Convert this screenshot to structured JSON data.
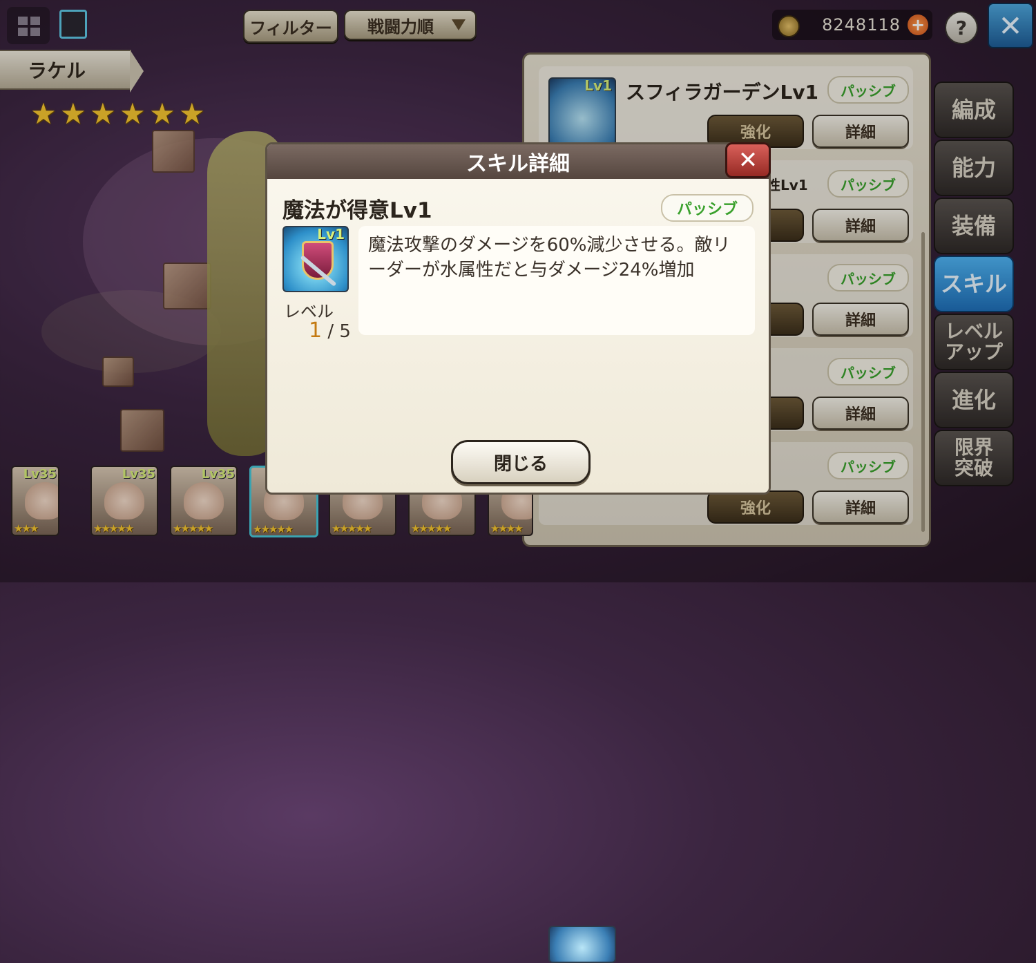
{
  "top_bar": {
    "filter_label": "フィルター",
    "sort_label": "戦闘力順",
    "currency_amount": "8248118",
    "help_icon": "?",
    "close_icon": "✕"
  },
  "character": {
    "name": "ラケル",
    "stars": 6
  },
  "skill_list": [
    {
      "title": "スフィラガーデンLv1",
      "type": "パッシブ",
      "enhance_label": "強化",
      "detail_label": "詳細",
      "icon_level": "Lv1"
    },
    {
      "title": "性Lv1",
      "type": "パッシブ",
      "enhance_label": "",
      "detail_label": "詳細"
    },
    {
      "title": "",
      "type": "パッシブ",
      "enhance_label": "",
      "detail_label": "詳細"
    },
    {
      "title": "",
      "type": "パッシブ",
      "enhance_label": "",
      "detail_label": "詳細"
    },
    {
      "title": "",
      "type": "パッシブ",
      "enhance_label": "強化",
      "detail_label": "詳細"
    }
  ],
  "side_menu": [
    "編成",
    "能力",
    "装備",
    "スキル",
    "レベル\nアップ",
    "進化",
    "限界\n突破"
  ],
  "side_menu_active": 3,
  "thumbnails": [
    {
      "level": "Lv35",
      "stars": "★★★"
    },
    {
      "level": "Lv35",
      "stars": "★★★★★"
    },
    {
      "level": "Lv35",
      "stars": "★★★★★"
    },
    {
      "level": "",
      "stars": "★★★★★"
    },
    {
      "level": "",
      "stars": "★★★★★"
    },
    {
      "level": "",
      "stars": "★★★★★"
    },
    {
      "level": "",
      "stars": "★★★★"
    }
  ],
  "modal": {
    "header": "スキル詳細",
    "skill_name": "魔法が得意Lv1",
    "skill_type": "パッシブ",
    "icon_level": "Lv1",
    "description": "魔法攻撃のダメージを60%減少させる。敵リーダーが水属性だと与ダメージ24%増加",
    "level_label": "レベル",
    "level_current": "1",
    "level_max": "/ 5",
    "close_button": "閉じる"
  },
  "colors": {
    "passive_text": "#3aa12d",
    "active_tab": "#2f8fd8",
    "modal_close": "#c2443d"
  }
}
